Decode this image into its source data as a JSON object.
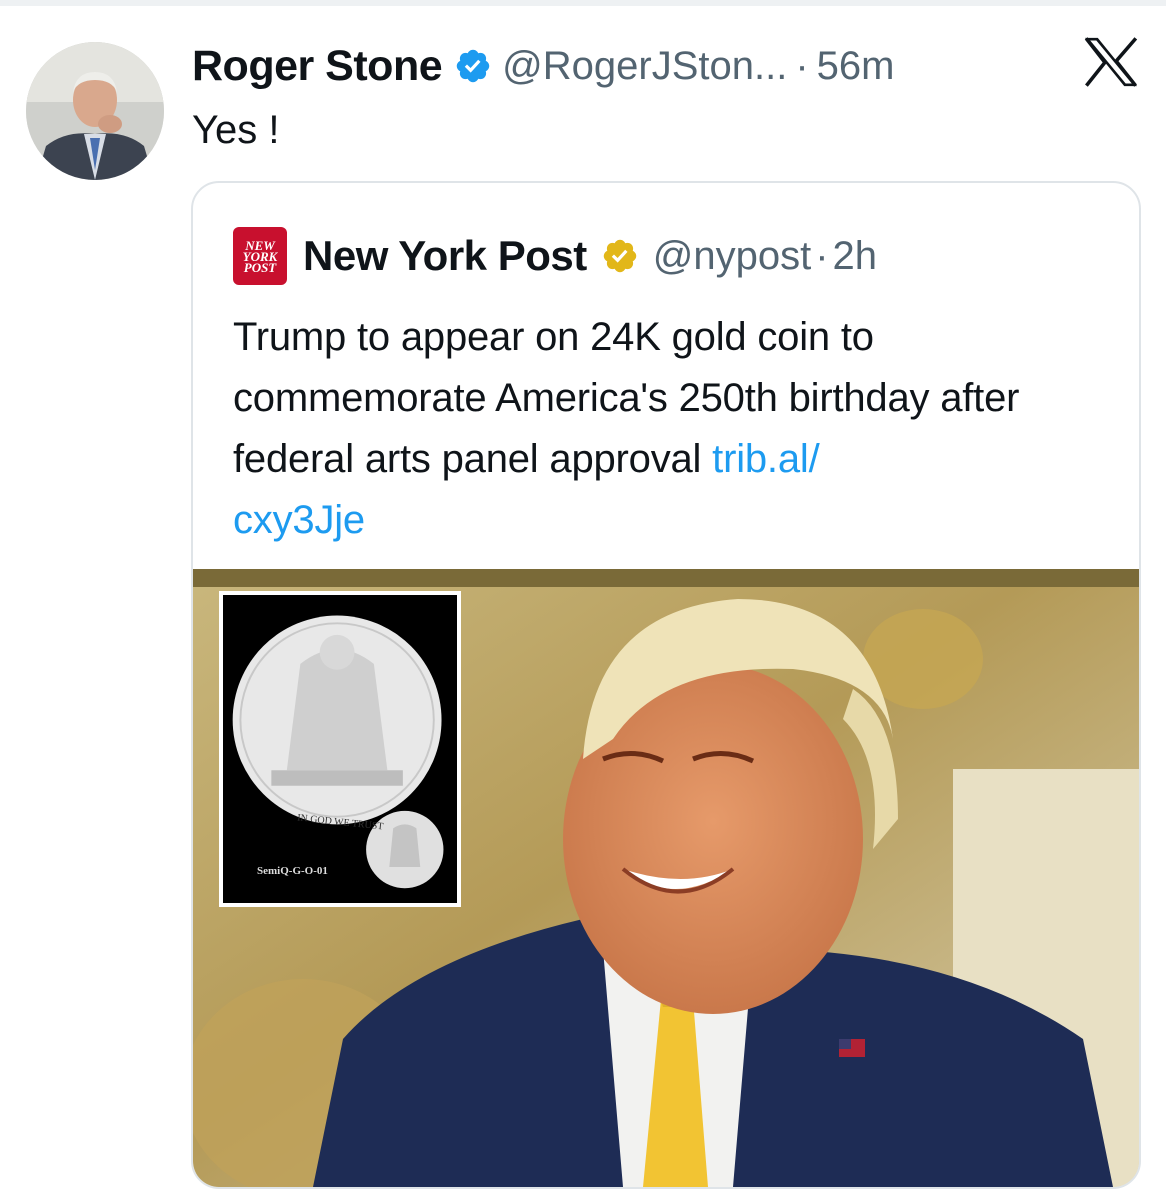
{
  "tweet": {
    "display_name": "Roger Stone",
    "handle": "@RogerJSton...",
    "separator": "·",
    "time": "56m",
    "text": "Yes !",
    "icons": {
      "avatar": "profile-photo",
      "verified": "verified-blue-check-icon",
      "close": "x-logo-icon"
    }
  },
  "quote": {
    "display_name": "New York Post",
    "logo_lines": [
      "NEW",
      "YORK",
      "POST"
    ],
    "handle": "@nypost",
    "separator": "·",
    "time": "2h",
    "text": "Trump to appear on 24K gold coin to commemorate America's 250th birthday after federal arts panel approval ",
    "link_text": "trib.al/\ncxy3Jje",
    "image": {
      "coin_motto": "IN GOD WE TRUST",
      "coin_code": "SemiQ-G-O-01"
    }
  },
  "colors": {
    "link": "#1d9bf0",
    "verified_blue": "#1d9bf0",
    "verified_gold": "#e2b719",
    "nypost_red": "#c8102e",
    "secondary_text": "#536471"
  }
}
